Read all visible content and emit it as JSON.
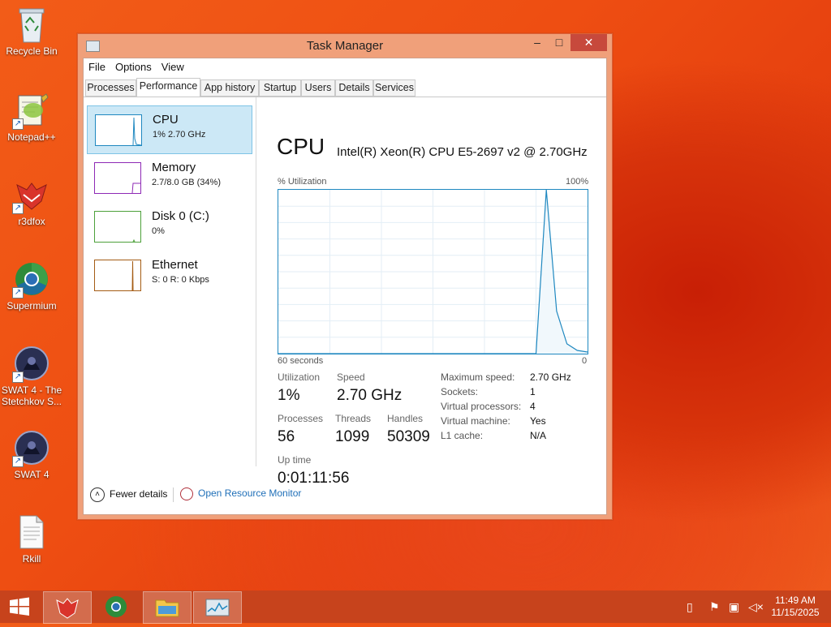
{
  "desktop": {
    "icons": [
      {
        "label": "Recycle Bin",
        "icon": "recycle-bin-icon"
      },
      {
        "label": "Notepad++",
        "icon": "notepad-plus-plus-icon"
      },
      {
        "label": "r3dfox",
        "icon": "r3dfox-icon"
      },
      {
        "label": "Supermium",
        "icon": "supermium-icon"
      },
      {
        "label": "SWAT 4 - The Stetchkov S...",
        "icon": "swat4-expansion-icon"
      },
      {
        "label": "SWAT 4",
        "icon": "swat4-icon"
      },
      {
        "label": "Rkill",
        "icon": "text-file-icon"
      }
    ]
  },
  "window": {
    "title": "Task Manager",
    "controls": {
      "minimize": "–",
      "maximize": "□",
      "close": "✕"
    },
    "menu": [
      "File",
      "Options",
      "View"
    ],
    "tabs": [
      "Processes",
      "Performance",
      "App history",
      "Startup",
      "Users",
      "Details",
      "Services"
    ],
    "active_tab": "Performance"
  },
  "resources": [
    {
      "name": "CPU",
      "detail": "1% 2.70 GHz",
      "color": "#1f88c0",
      "selected": true
    },
    {
      "name": "Memory",
      "detail": "2.7/8.0 GB (34%)",
      "color": "#8e29b5",
      "selected": false
    },
    {
      "name": "Disk 0 (C:)",
      "detail": "0%",
      "color": "#4da03a",
      "selected": false
    },
    {
      "name": "Ethernet",
      "detail": "S: 0 R: 0 Kbps",
      "color": "#a45c14",
      "selected": false
    }
  ],
  "cpu": {
    "title": "CPU",
    "model": "Intel(R) Xeon(R) CPU E5-2697 v2 @ 2.70GHz",
    "util_label": "% Utilization",
    "max_label": "100%",
    "time_label": "60 seconds",
    "zero_label": "0",
    "stats": {
      "utilization_label": "Utilization",
      "utilization": "1%",
      "speed_label": "Speed",
      "speed": "2.70 GHz",
      "processes_label": "Processes",
      "processes": "56",
      "threads_label": "Threads",
      "threads": "1099",
      "handles_label": "Handles",
      "handles": "50309",
      "uptime_label": "Up time",
      "uptime": "0:01:11:56"
    },
    "specs": [
      {
        "label": "Maximum speed:",
        "value": "2.70 GHz"
      },
      {
        "label": "Sockets:",
        "value": "1"
      },
      {
        "label": "Virtual processors:",
        "value": "4"
      },
      {
        "label": "Virtual machine:",
        "value": "Yes"
      },
      {
        "label": "L1 cache:",
        "value": "N/A"
      }
    ]
  },
  "chart_data": {
    "type": "line",
    "ylabel": "% Utilization",
    "ylim": [
      0,
      100
    ],
    "xlim": [
      60,
      0
    ],
    "x": [
      60,
      56,
      52,
      48,
      44,
      40,
      36,
      34,
      33.5,
      33,
      32.5,
      32,
      31,
      30,
      28,
      26,
      24,
      22,
      20,
      18,
      16,
      14,
      12,
      10,
      8,
      6,
      4,
      2,
      0
    ],
    "series": [
      {
        "values": [
          0,
          0,
          0,
          0,
          0,
          0,
          0,
          0,
          0,
          0,
          0,
          0,
          0,
          0,
          0,
          0,
          0,
          0,
          0,
          0,
          0,
          0,
          0,
          0,
          100,
          26,
          6,
          2,
          1
        ]
      }
    ]
  },
  "footer": {
    "fewer_details": "Fewer details",
    "open_resource_monitor": "Open Resource Monitor"
  },
  "taskbar": {
    "time": "11:49 AM",
    "date": "11/15/2025",
    "items": [
      "start-icon",
      "r3dfox-icon",
      "supermium-icon",
      "file-explorer-icon",
      "task-manager-icon"
    ]
  }
}
